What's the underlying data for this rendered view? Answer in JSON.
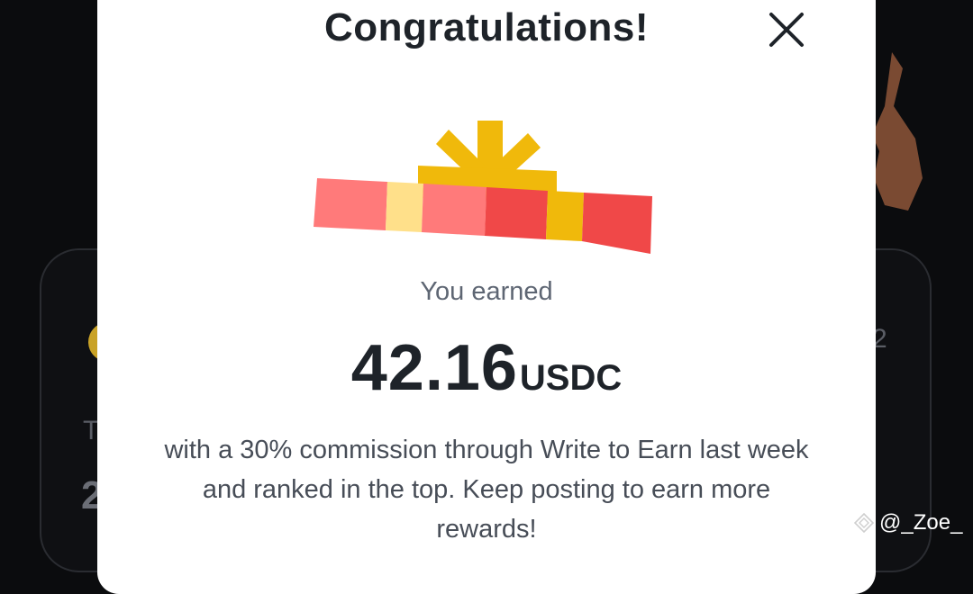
{
  "background": {
    "partial_text_left": "To",
    "partial_number_left": "2",
    "partial_text_right": "2"
  },
  "modal": {
    "title": "Congratulations!",
    "close_icon": "close-icon",
    "illustration": "gift-icon",
    "earned_label": "You earned",
    "amount": "42.16",
    "currency": "USDC",
    "description": "with a 30% commission through Write to Earn last week and ranked in the top. Keep posting to earn more rewards!"
  },
  "watermark": {
    "icon": "diamond-logo-icon",
    "handle": "@_Zoe_"
  },
  "colors": {
    "accent_gold": "#F0B90B",
    "ribbon_red": "#F6465D",
    "text_primary": "#1E2329",
    "text_secondary": "#5E6673"
  }
}
